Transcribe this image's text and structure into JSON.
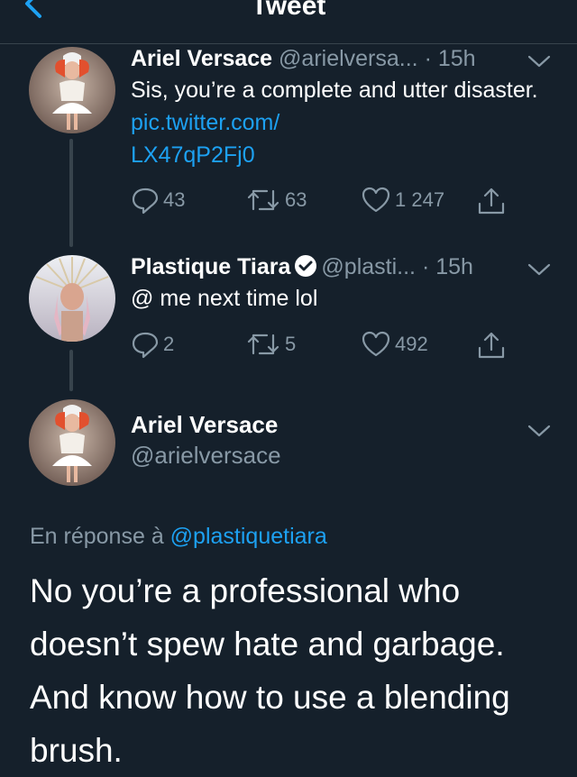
{
  "header": {
    "title": "Tweet"
  },
  "colors": {
    "background": "#15202b",
    "accent": "#1da1f2",
    "muted": "#8899a6",
    "border": "#38444d"
  },
  "tweets": [
    {
      "name": "Ariel Versace",
      "handle": "@arielversa...",
      "time": "· 15h",
      "text": "Sis, you’re a complete and utter disaster. ",
      "link_line1": "pic.twitter.com/",
      "link_line2": "LX47qP2Fj0",
      "replies": "43",
      "retweets": "63",
      "likes": "1 247"
    },
    {
      "name": "Plastique Tiara",
      "handle": "@plasti...",
      "time": "· 15h",
      "text": "@ me next time lol",
      "replies": "2",
      "retweets": "5",
      "likes": "492"
    }
  ],
  "main_tweet": {
    "name": "Ariel Versace",
    "handle": "@arielversace",
    "reply_prefix": "En réponse à ",
    "reply_handle": "@plastiquetiara",
    "text": "No you’re a professional who doesn’t spew hate and garbage. And know how to use a blending brush."
  },
  "icons": {
    "back": "chevron-left-icon",
    "more": "chevron-down-icon",
    "reply": "speech-bubble-icon",
    "retweet": "retweet-arrows-icon",
    "like": "heart-icon",
    "share": "share-upload-icon",
    "verified": "verified-badge-icon"
  }
}
